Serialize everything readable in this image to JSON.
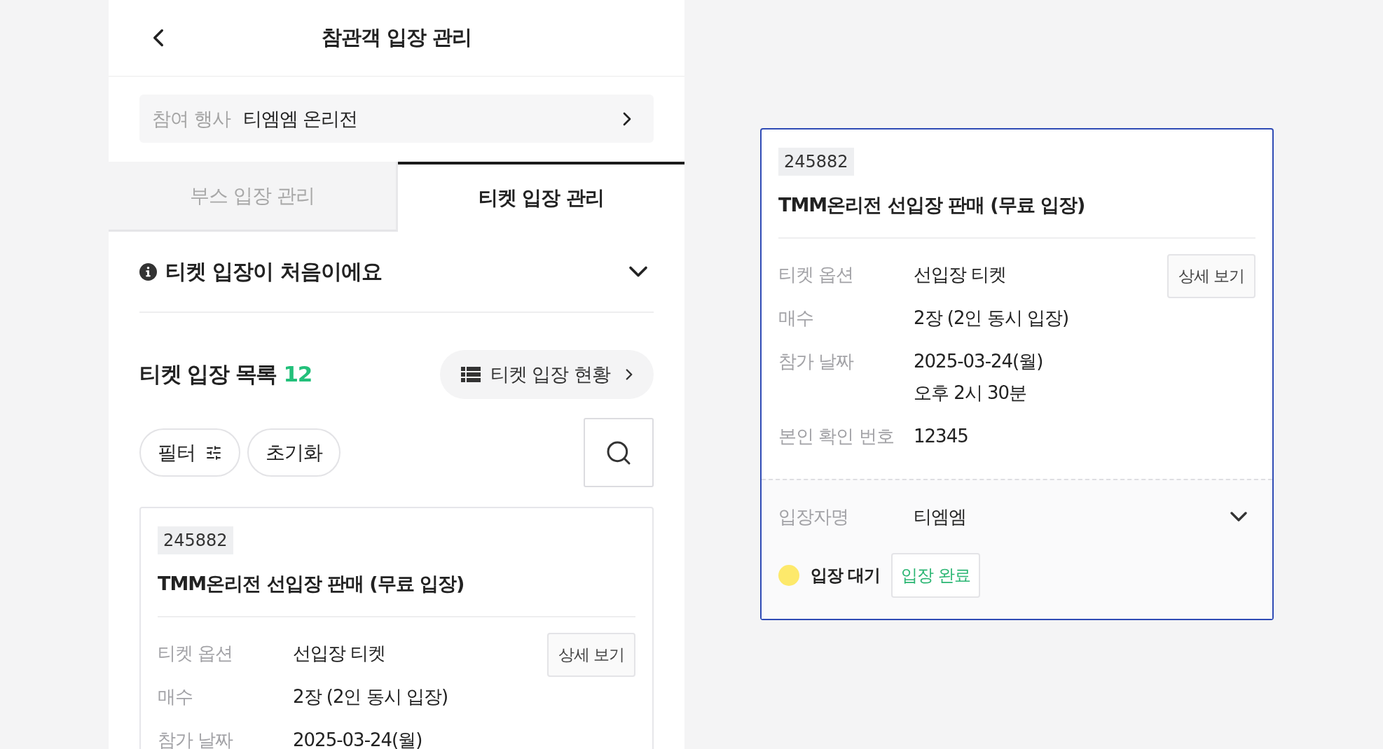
{
  "header": {
    "title": "참관객 입장 관리"
  },
  "event_selector": {
    "label": "참여 행사",
    "value": "티엠엠 온리전"
  },
  "tabs": [
    {
      "label": "부스 입장 관리",
      "selected": false
    },
    {
      "label": "티켓 입장 관리",
      "selected": true
    }
  ],
  "notice": {
    "text": "티켓 입장이 처음이에요",
    "expanded": false
  },
  "list_header": {
    "title": "티켓 입장 목록",
    "count": "12",
    "status_button": "티켓 입장 현황"
  },
  "filters": [
    {
      "label": "필터",
      "kind": "filter"
    },
    {
      "label": "초기화",
      "kind": "reset"
    }
  ],
  "ticket_list": [
    {
      "code": "245882",
      "title": "TMM온리전 선입장 판매 (무료 입장)",
      "detail_button": "상세 보기",
      "fields": [
        {
          "label": "티켓 옵션",
          "lines": [
            "선입장 티켓"
          ]
        },
        {
          "label": "매수",
          "lines": [
            "2장 (2인 동시 입장)"
          ]
        },
        {
          "label": "참가 날짜",
          "lines": [
            "2025-03-24(월)"
          ]
        }
      ]
    }
  ],
  "ticket_detail": {
    "code": "245882",
    "title": "TMM온리전 선입장 판매 (무료 입장)",
    "detail_button": "상세 보기",
    "fields": [
      {
        "label": "티켓 옵션",
        "lines": [
          "선입장 티켓"
        ]
      },
      {
        "label": "매수",
        "lines": [
          "2장 (2인 동시 입장)"
        ]
      },
      {
        "label": "참가 날짜",
        "lines": [
          "2025-03-24(월)",
          "오후 2시 30분"
        ]
      },
      {
        "label": "본인 확인 번호",
        "lines": [
          "12345"
        ]
      }
    ],
    "entrant": {
      "label": "입장자명",
      "value": "티엠엠",
      "expanded": false
    },
    "status": {
      "label": "입장 대기",
      "color": "#fde96b"
    },
    "complete_button": "입장 완료"
  }
}
